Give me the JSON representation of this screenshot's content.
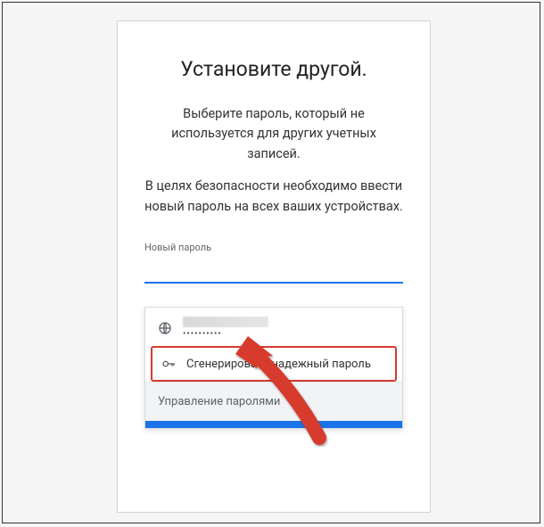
{
  "title": "Установите другой.",
  "subtitle": "Выберите пароль, который не используется для других учетных записей.",
  "note": "В целях безопасности необходимо ввести новый пароль на всех ваших устройствах.",
  "field_label": "Новый пароль",
  "dropdown": {
    "saved_password_mask": "••••••••••",
    "generate_label": "Сгенерировать надежный пароль",
    "manage_label": "Управление паролями"
  }
}
